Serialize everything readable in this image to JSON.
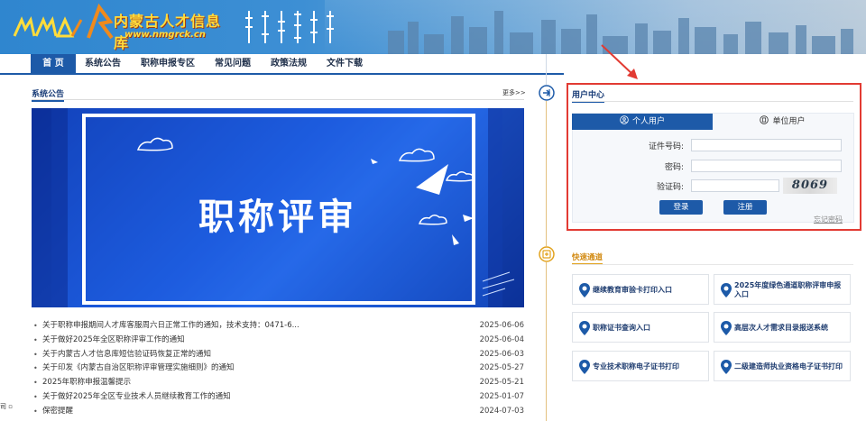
{
  "header": {
    "logo_text": "内蒙古人才信息库",
    "logo_url": "www.nmgrck.cn"
  },
  "nav": {
    "items": [
      {
        "label": "首 页"
      },
      {
        "label": "系统公告"
      },
      {
        "label": "职称申报专区"
      },
      {
        "label": "常见问题"
      },
      {
        "label": "政策法规"
      },
      {
        "label": "文件下载"
      }
    ]
  },
  "announcements": {
    "title": "系统公告",
    "more": "更多>>",
    "banner_title": "职称评审",
    "items": [
      {
        "title": "关于职称申报期间人才库客服周六日正常工作的通知，技术支持：0471-6...",
        "date": "2025-06-06"
      },
      {
        "title": "关于做好2025年全区职称评审工作的通知",
        "date": "2025-06-04"
      },
      {
        "title": "关于内蒙古人才信息库短信验证码恢复正常的通知",
        "date": "2025-06-03"
      },
      {
        "title": "关于印发《内蒙古自治区职称评审管理实施细则》的通知",
        "date": "2025-05-27"
      },
      {
        "title": "2025年职称申报温馨提示",
        "date": "2025-05-21"
      },
      {
        "title": "关于做好2025年全区专业技术人员继续教育工作的通知",
        "date": "2025-01-07"
      },
      {
        "title": "保密提醒",
        "date": "2024-07-03"
      }
    ]
  },
  "side_stub": "司 ▫",
  "user_center": {
    "title": "用户中心",
    "tab_personal": "个人用户",
    "tab_unit": "单位用户",
    "id_label": "证件号码:",
    "password_label": "密码:",
    "captcha_label": "验证码:",
    "captcha_value": "8069",
    "login": "登录",
    "register": "注册",
    "forgot": "忘记密码"
  },
  "quick": {
    "title": "快速通道",
    "items": [
      {
        "label": "继续教育审验卡打印入口"
      },
      {
        "label": "2025年度绿色通道职称评审申报入口"
      },
      {
        "label": "职称证书查询入口"
      },
      {
        "label": "高层次人才需求目录报送系统"
      },
      {
        "label": "专业技术职称电子证书打印"
      },
      {
        "label": "二级建造师执业资格电子证书打印"
      }
    ]
  },
  "colors": {
    "nav_blue": "#1d5aa8",
    "highlight_red": "#e23b33",
    "quick_orange": "#e2a21d"
  }
}
